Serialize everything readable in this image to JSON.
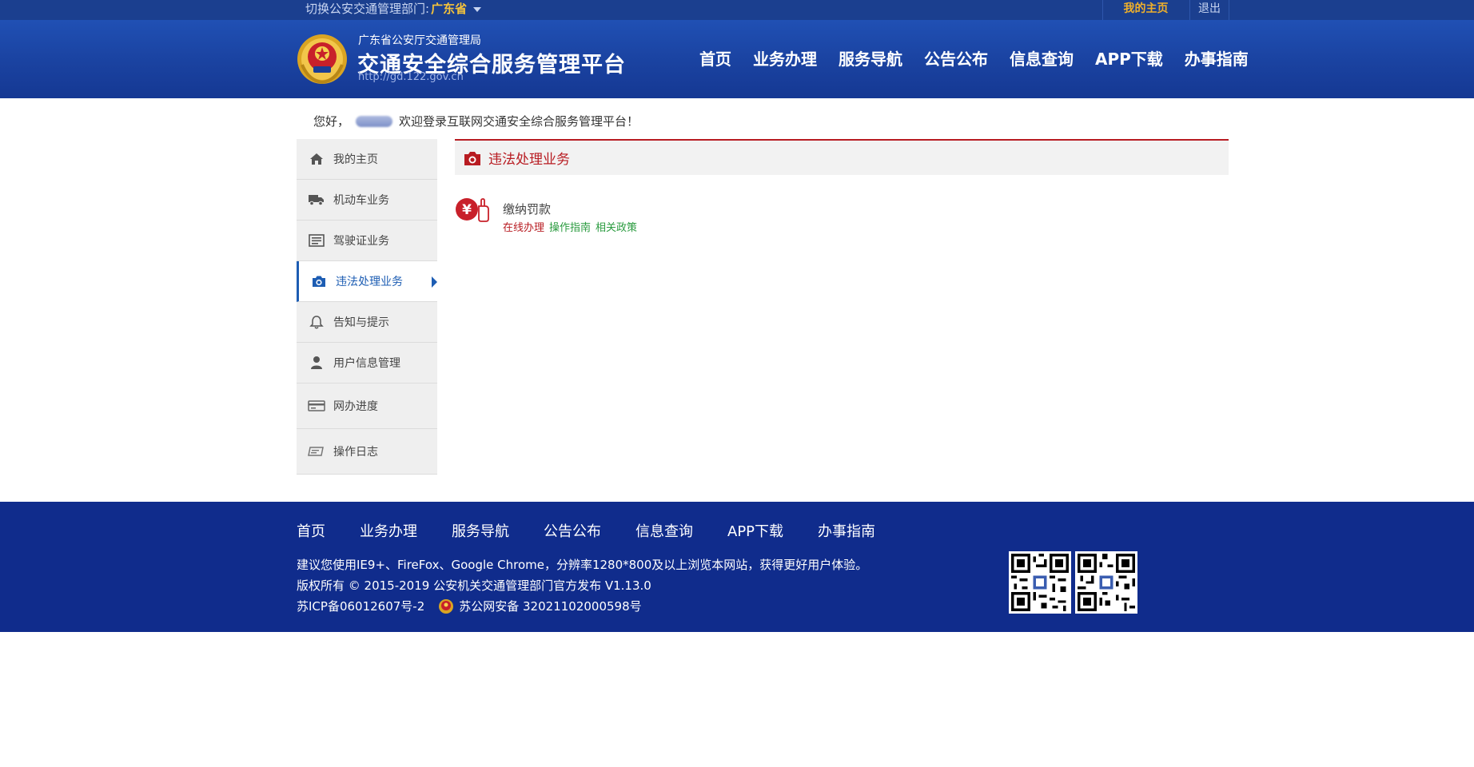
{
  "topbar": {
    "switch_label": "切换公安交通管理部门:",
    "province": "广东省",
    "my_home": "我的主页",
    "logout": "退出"
  },
  "header": {
    "subtitle": "广东省公安厅交通管理局",
    "title": "交通安全综合服务管理平台",
    "url": "http://gd.122.gov.cn",
    "nav": [
      "首页",
      "业务办理",
      "服务导航",
      "公告公布",
      "信息查询",
      "APP下载",
      "办事指南"
    ]
  },
  "welcome": {
    "greeting": "您好，",
    "message": "欢迎登录互联网交通安全综合服务管理平台！"
  },
  "sidebar": {
    "items": [
      {
        "label": "我的主页",
        "icon": "home-icon"
      },
      {
        "label": "机动车业务",
        "icon": "truck-icon"
      },
      {
        "label": "驾驶证业务",
        "icon": "license-icon"
      },
      {
        "label": "违法处理业务",
        "icon": "camera-icon"
      },
      {
        "label": "告知与提示",
        "icon": "bell-icon"
      },
      {
        "label": "用户信息管理",
        "icon": "user-icon"
      },
      {
        "label": "网办进度",
        "icon": "card-icon"
      },
      {
        "label": "操作日志",
        "icon": "log-icon"
      }
    ],
    "active_index": 3
  },
  "content": {
    "section_title": "违法处理业务",
    "service": {
      "name": "缴纳罚款",
      "link_online": "在线办理",
      "link_guide": "操作指南",
      "link_policy": "相关政策",
      "icon": "yen-payment-icon"
    }
  },
  "footer": {
    "nav": [
      "首页",
      "业务办理",
      "服务导航",
      "公告公布",
      "信息查询",
      "APP下载",
      "办事指南"
    ],
    "browser_tip": "建议您使用IE9+、FireFox、Google Chrome，分辨率1280*800及以上浏览本网站，获得更好用户体验。",
    "copyright": "版权所有 © 2015-2019 公安机关交通管理部门官方发布 V1.13.0",
    "icp": "苏ICP备06012607号-2",
    "police_record": "苏公网安备 32021102000598号"
  },
  "colors": {
    "header_blue": "#1a42a0",
    "footer_blue": "#102c8c",
    "accent_red": "#b81c22",
    "active_blue": "#1d5db3",
    "link_green": "#2a9b3f",
    "gold": "#f0b02a"
  }
}
